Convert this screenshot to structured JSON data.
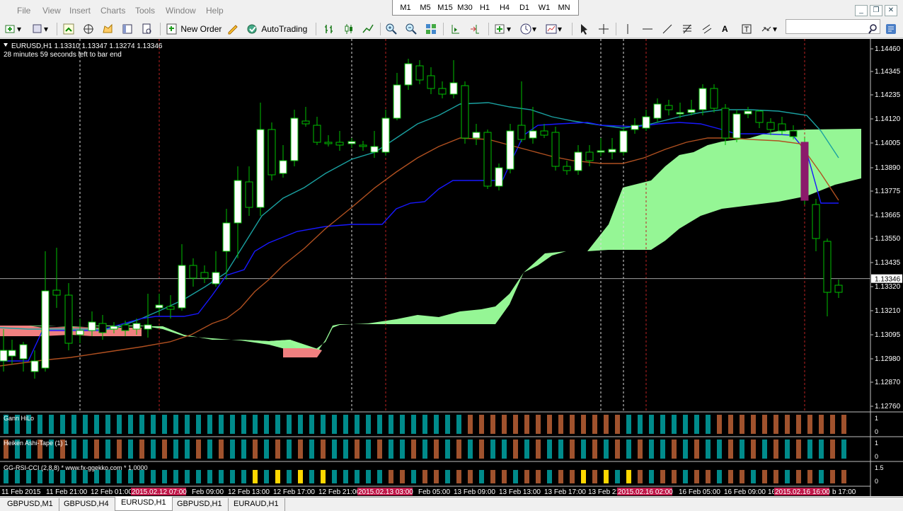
{
  "menu": [
    "File",
    "View",
    "Insert",
    "Charts",
    "Tools",
    "Window",
    "Help"
  ],
  "timeframes": [
    "M1",
    "M5",
    "M15",
    "M30",
    "H1",
    "H4",
    "D1",
    "W1",
    "MN"
  ],
  "toolbar": {
    "new_order": "New Order",
    "autotrading": "AutoTrading"
  },
  "chart": {
    "symbol_line": "EURUSD,H1  1.13310 1.13347 1.13274 1.13346",
    "bar_timer": "28 minutes 59 seconds left to bar end",
    "current_price": "1.13346",
    "price_labels": [
      "1.14460",
      "1.14345",
      "1.14235",
      "1.14120",
      "1.14005",
      "1.13890",
      "1.13775",
      "1.13665",
      "1.13550",
      "1.13435",
      "1.13320",
      "1.13210",
      "1.13095",
      "1.12980",
      "1.12870",
      "1.12760"
    ],
    "time_labels": [
      "11 Feb 2015",
      "11 Feb 21:00",
      "12 Feb 01:00",
      "2015.02.12 07:00",
      "Feb 09:00",
      "12 Feb 13:00",
      "12 Feb 17:00",
      "12 Feb 21:00",
      "2015.02.13 03:00",
      "Feb 05:00",
      "13 Feb 09:00",
      "13 Feb 13:00",
      "13 Feb 17:00",
      "13 Feb 21",
      "2015.02.16 02:00",
      "16 Feb 05:00",
      "16 Feb 09:00",
      "16",
      "2015.02.16 16:00",
      "b 17:00"
    ]
  },
  "indicators": [
    {
      "name": "Gann HiLo",
      "scale": [
        "1",
        "0"
      ]
    },
    {
      "name": "Heiken Ashi-Tape (1) 1",
      "scale": [
        "1",
        "0"
      ]
    },
    {
      "name": "GG-RSI-CCI (2,8,8) * www.fx-ggekko.com *  1.0000",
      "scale": [
        "1.5",
        "0"
      ]
    }
  ],
  "tabs": [
    "GBPUSD,M1",
    "GBPUSD,H4",
    "EURUSD,H1",
    "GBPUSD,H1",
    "EURAUD,H1"
  ],
  "active_tab": "EURUSD,H1",
  "chart_data": {
    "type": "candlestick",
    "colors": {
      "up": "#ffffff",
      "down": "#000000",
      "wick": "#00c000",
      "cloud_bull": "#98fb98",
      "cloud_bear": "#f08080",
      "tenkan": "#1818ff",
      "kijun": "#1aa0a0",
      "ma": "#b05020",
      "teal_bar": "#008b8b",
      "brown_bar": "#a0522d",
      "yellow_bar": "#ffd700"
    }
  }
}
